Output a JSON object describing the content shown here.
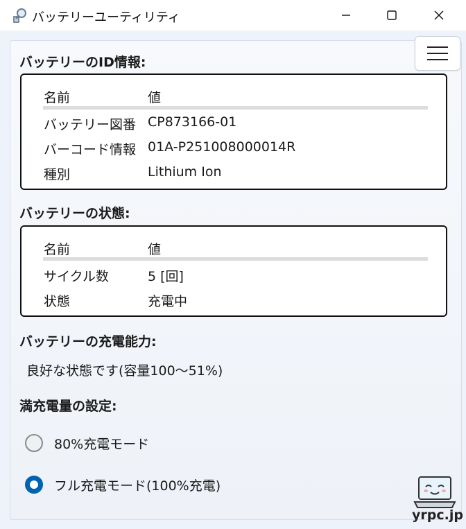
{
  "window": {
    "title": "バッテリーユーティリティ"
  },
  "id_section": {
    "title": "バッテリーのID情報:",
    "header": {
      "name": "名前",
      "value": "値"
    },
    "rows": [
      {
        "name": "バッテリー図番",
        "value": "CP873166-01"
      },
      {
        "name": "バーコード情報",
        "value": "01A-P251008000014R"
      },
      {
        "name": "種別",
        "value": "Lithium Ion"
      }
    ]
  },
  "state_section": {
    "title": "バッテリーの状態:",
    "header": {
      "name": "名前",
      "value": "値"
    },
    "rows": [
      {
        "name": "サイクル数",
        "value": "5 [回]"
      },
      {
        "name": "状態",
        "value": "充電中"
      }
    ]
  },
  "capacity_section": {
    "title": "バッテリーの充電能力:",
    "status": "良好な状態です(容量100〜51%)"
  },
  "charge_setting": {
    "title": "満充電量の設定:",
    "options": [
      {
        "label": "80%充電モード",
        "selected": false
      },
      {
        "label": "フル充電モード(100%充電)",
        "selected": true
      }
    ]
  },
  "watermark": {
    "site": "yrpc.jp"
  },
  "colors": {
    "accent": "#0063b1"
  }
}
